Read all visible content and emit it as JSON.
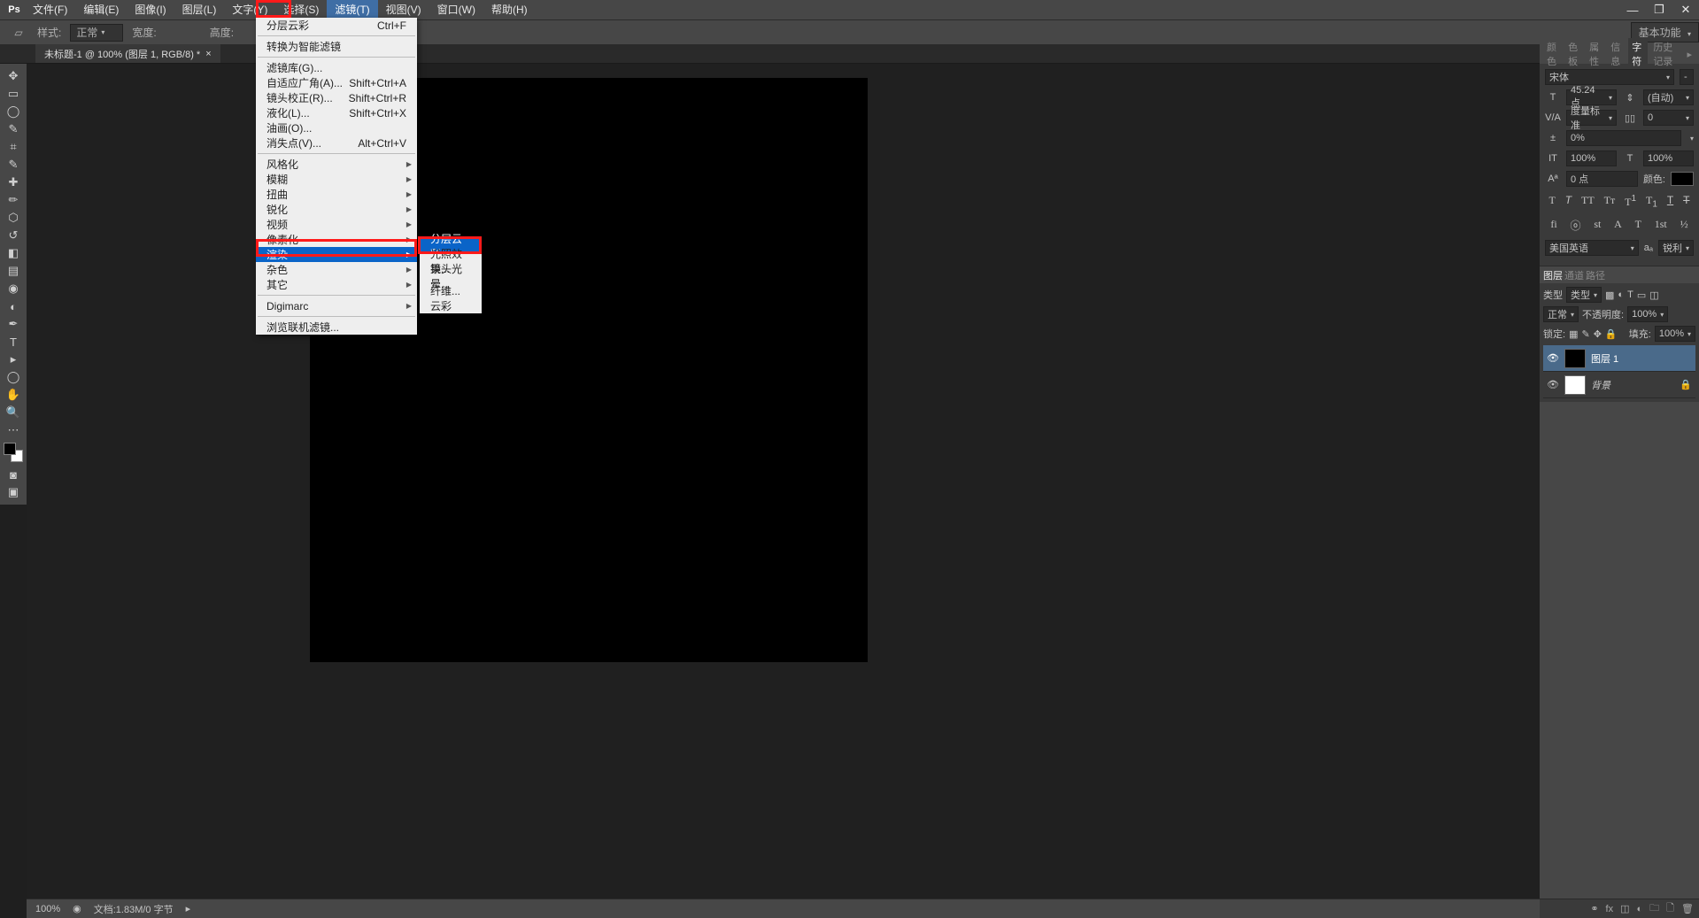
{
  "menubar": {
    "items": [
      "文件(F)",
      "编辑(E)",
      "图像(I)",
      "图层(L)",
      "文字(Y)",
      "选择(S)",
      "滤镜(T)",
      "视图(V)",
      "窗口(W)",
      "帮助(H)"
    ],
    "active_index": 6
  },
  "options_bar": {
    "style_label": "样式:",
    "style_value": "正常",
    "width_label": "宽度:",
    "height_label": "高度:",
    "workspace_button": "基本功能"
  },
  "doc_tab": {
    "title": "未标题-1 @ 100% (图层 1, RGB/8) *"
  },
  "filter_menu": {
    "last": "分层云彩",
    "last_shortcut": "Ctrl+F",
    "convert": "转换为智能滤镜",
    "gallery": "滤镜库(G)...",
    "adaptive": "自适应广角(A)...",
    "adaptive_sc": "Shift+Ctrl+A",
    "lens": "镜头校正(R)...",
    "lens_sc": "Shift+Ctrl+R",
    "liquify": "液化(L)...",
    "liquify_sc": "Shift+Ctrl+X",
    "oil": "油画(O)...",
    "vanish": "消失点(V)...",
    "vanish_sc": "Alt+Ctrl+V",
    "stylize": "风格化",
    "blur": "模糊",
    "distort": "扭曲",
    "sharpen": "锐化",
    "video": "视频",
    "pixelate": "像素化",
    "render": "渲染",
    "distort_color": "杂色",
    "other": "其它",
    "digimarc": "Digimarc",
    "browse": "浏览联机滤镜..."
  },
  "render_submenu": {
    "diff_clouds": "分层云彩",
    "lighting": "光照效果...",
    "lens_flare": "镜头光晕...",
    "fibers": "纤维...",
    "clouds": "云彩"
  },
  "right_tabs": {
    "color": "颜色",
    "swatches": "色板",
    "properties": "属性",
    "info": "信息",
    "character": "字符",
    "history": "历史记录"
  },
  "character": {
    "font_family": "宋体",
    "font_style": "-",
    "size": "45.24 点",
    "leading": "(自动)",
    "tracking": "度量标准",
    "kerning": "0",
    "baseline": "0%",
    "scale_v": "100%",
    "scale_h": "100%",
    "shift": "0 点",
    "color_label": "颜色:",
    "lang": "美国英语",
    "aa": "锐利"
  },
  "layers_tabs": {
    "layers": "图层",
    "channels": "通道",
    "paths": "路径"
  },
  "layers": {
    "kind_label": "类型",
    "blend_mode": "正常",
    "opacity_label": "不透明度:",
    "opacity_value": "100%",
    "lock_label": "锁定:",
    "fill_label": "填充:",
    "fill_value": "100%",
    "layer1": "图层 1",
    "background": "背景"
  },
  "status": {
    "zoom": "100%",
    "doc_info": "文档:1.83M/0 字节"
  }
}
